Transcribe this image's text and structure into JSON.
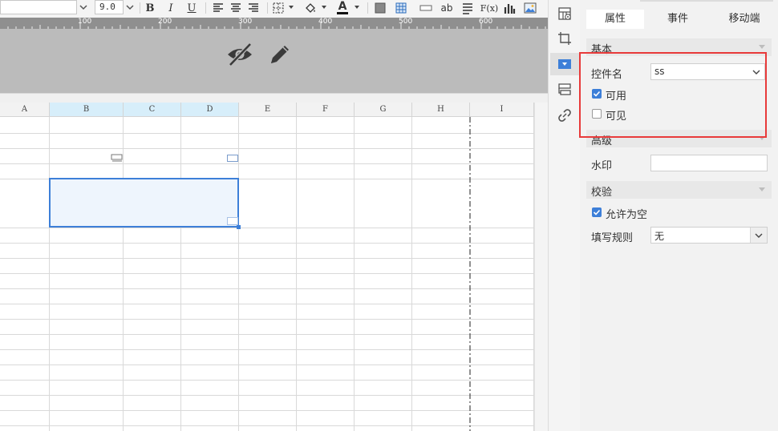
{
  "toolbar": {
    "font_size_value": "9.0",
    "bold_label": "B",
    "italic_label": "I",
    "underline_label": "U",
    "align_left_label": "≡",
    "align_center_label": "≡",
    "align_right_label": "≡",
    "text_label": "ab",
    "formula_label": "F(x)",
    "font_color_label": "A"
  },
  "ruler": {
    "marks": [
      "100",
      "200",
      "300",
      "400",
      "500",
      "600"
    ]
  },
  "sheet": {
    "columns": [
      "A",
      "B",
      "C",
      "D",
      "E",
      "F",
      "G",
      "H",
      "I"
    ],
    "selected_columns": [
      "B",
      "C",
      "D"
    ]
  },
  "panel": {
    "tabs": [
      "属性",
      "事件",
      "移动端"
    ],
    "active_tab": "属性",
    "section_basic": "基本",
    "widget_name_label": "控件名",
    "widget_name_value": "ss",
    "enabled_label": "可用",
    "enabled_checked": true,
    "visible_label": "可见",
    "visible_checked": false,
    "section_advanced": "高级",
    "watermark_label": "水印",
    "watermark_value": "",
    "section_validation": "校验",
    "allow_empty_label": "允许为空",
    "allow_empty_checked": true,
    "fill_rule_label": "填写规则",
    "fill_rule_value": "无"
  },
  "colors": {
    "accent_blue": "#3d7fd8",
    "highlight_red": "#e83a3a",
    "canvas_gray": "#bbbbbb",
    "selected_column_bg": "#d7eefa",
    "selection_fill": "#eef5fd"
  }
}
